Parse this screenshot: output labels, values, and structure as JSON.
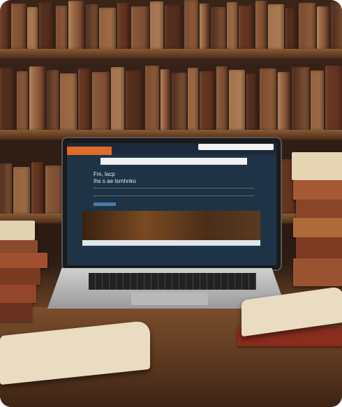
{
  "screen": {
    "brand_color": "#e06a28",
    "heading_line1": "Fm, lacp",
    "heading_line2": "Ihs s ae tsrnhnko"
  },
  "colors": {
    "spines": [
      "#6b3a24",
      "#8a5a3a",
      "#a0704a",
      "#5a2e1c",
      "#7a4a30",
      "#b08058",
      "#4a2a1c",
      "#93603c"
    ]
  }
}
